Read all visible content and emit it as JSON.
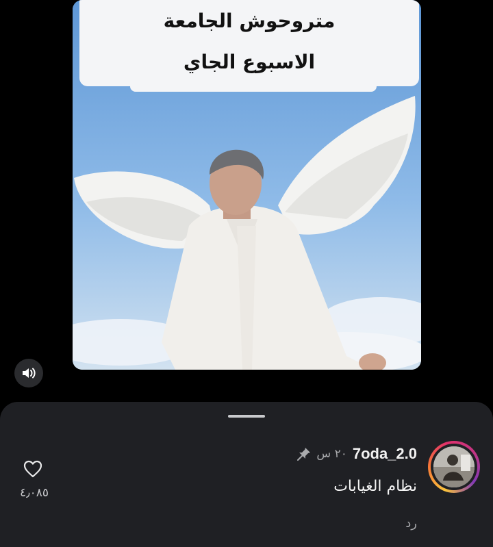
{
  "video": {
    "caption_line_1": "متروحوش الجامعة",
    "caption_line_2": "الاسبوع الجاي",
    "sound_icon": "speaker-icon"
  },
  "comment": {
    "username": "7oda_2.0",
    "time": "٢٠ س",
    "pinned_icon": "pin-icon",
    "text": "نظام الغيابات",
    "reply_label": "رد",
    "like_icon": "heart-icon",
    "like_count": "٤٫٠٨٥"
  },
  "colors": {
    "sheet_background": "#1f2024",
    "page_background": "#000000",
    "avatar_ring": "#e1306c"
  }
}
